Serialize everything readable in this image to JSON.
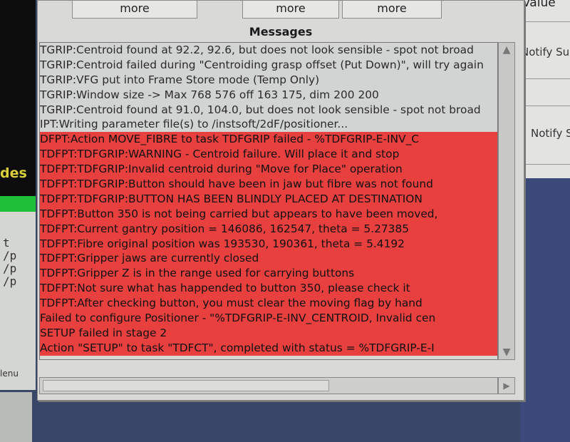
{
  "background_fragments": {
    "modes_label": "des",
    "left_cut_lines": [
      "t",
      "/p",
      "/p",
      "/p"
    ],
    "menu_label": "lenu",
    "right_header": "Value",
    "notify_1": "Notify Sup",
    "notify_2": "Notify S"
  },
  "window": {
    "more_buttons": [
      {
        "label": "more"
      },
      {
        "label": "more"
      },
      {
        "label": "more"
      }
    ],
    "title": "Messages",
    "scroll_up_icon": "▲",
    "scroll_down_icon": "▼",
    "scroll_left_icon": "◀",
    "scroll_right_icon": "▶"
  },
  "messages": [
    {
      "text": "TGRIP:Centroid found at 92.2, 92.6, but does not look sensible - spot not broad",
      "severity": "info"
    },
    {
      "text": "TGRIP:Centroid failed during \"Centroiding grasp offset (Put Down)\", will try again",
      "severity": "info"
    },
    {
      "text": "TGRIP:VFG put into Frame Store mode (Temp Only)",
      "severity": "info"
    },
    {
      "text": "TGRIP:Window size -> Max 768 576 off 163 175, dim 200 200",
      "severity": "info"
    },
    {
      "text": "TGRIP:Centroid found at 91.0, 104.0, but does not look sensible - spot not broad",
      "severity": "info"
    },
    {
      "text": "IPT:Writing parameter file(s) to /instsoft/2dF/positioner...",
      "severity": "info"
    },
    {
      "text": "DFPT:Action MOVE_FIBRE to task TDFGRIP failed - %TDFGRIP-E-INV_C",
      "severity": "error"
    },
    {
      "text": "TDFPT:TDFGRIP:WARNING - Centroid failure.  Will place it and stop",
      "severity": "error"
    },
    {
      "text": "TDFPT:TDFGRIP:Invalid centroid during \"Move for Place\" operation",
      "severity": "error"
    },
    {
      "text": "TDFPT:TDFGRIP:Button should have been in jaw but fibre was not found",
      "severity": "error"
    },
    {
      "text": "TDFPT:TDFGRIP:BUTTON HAS BEEN BLINDLY PLACED AT DESTINATION",
      "severity": "error"
    },
    {
      "text": "TDFPT:Button 350 is not being carried but appears to have been moved,",
      "severity": "error"
    },
    {
      "text": "TDFPT:Current gantry position = 146086, 162547, theta = 5.27385",
      "severity": "error"
    },
    {
      "text": "TDFPT:Fibre original position was 193530, 190361, theta = 5.4192",
      "severity": "error"
    },
    {
      "text": "TDFPT:Gripper jaws are currently closed",
      "severity": "error"
    },
    {
      "text": "TDFPT:Gripper Z is in the range used for carrying buttons",
      "severity": "error"
    },
    {
      "text": "TDFPT:Not sure what has happended to button 350, please check it",
      "severity": "error"
    },
    {
      "text": "TDFPT:After checking button, you must clear the moving flag by hand",
      "severity": "error"
    },
    {
      "text": "Failed to configure Positioner - \"%TDFGRIP-E-INV_CENTROID, Invalid cen",
      "severity": "error"
    },
    {
      "text": "SETUP failed in stage 2",
      "severity": "error"
    },
    {
      "text": "Action \"SETUP\" to task \"TDFCT\", completed with status = %TDFGRIP-E-I",
      "severity": "error"
    }
  ],
  "colors": {
    "error_bg": "#e8403e",
    "info_bg": "#d2d4d3",
    "modes_text": "#d8cf3a",
    "green_bar": "#1fbf3a"
  }
}
